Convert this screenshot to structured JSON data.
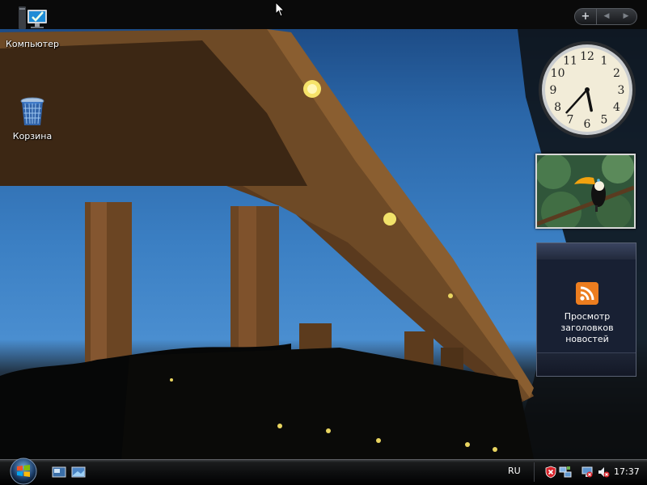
{
  "desktop": {
    "icons": [
      {
        "label": "Компьютер",
        "icon": "computer-icon"
      },
      {
        "label": "Корзина",
        "icon": "recycle-bin-icon"
      }
    ]
  },
  "sidebar": {
    "controls": {
      "add": "+",
      "prev": "◀",
      "next": "▶"
    },
    "clock": {
      "hour_numbers": [
        "12",
        "1",
        "2",
        "3",
        "4",
        "5",
        "6",
        "7",
        "8",
        "9",
        "10",
        "11"
      ],
      "hour": 5,
      "minute": 37
    },
    "feed": {
      "label": "Просмотр заголовков новостей",
      "icon": "rss-icon"
    }
  },
  "taskbar": {
    "start_icon": "windows-start-orb",
    "quick_launch": [
      "show-desktop-icon",
      "switch-windows-icon"
    ],
    "language": "RU",
    "tray_icons": [
      "security-alert-icon",
      "network-icon",
      "volume-muted-icon"
    ],
    "time": "17:37"
  }
}
